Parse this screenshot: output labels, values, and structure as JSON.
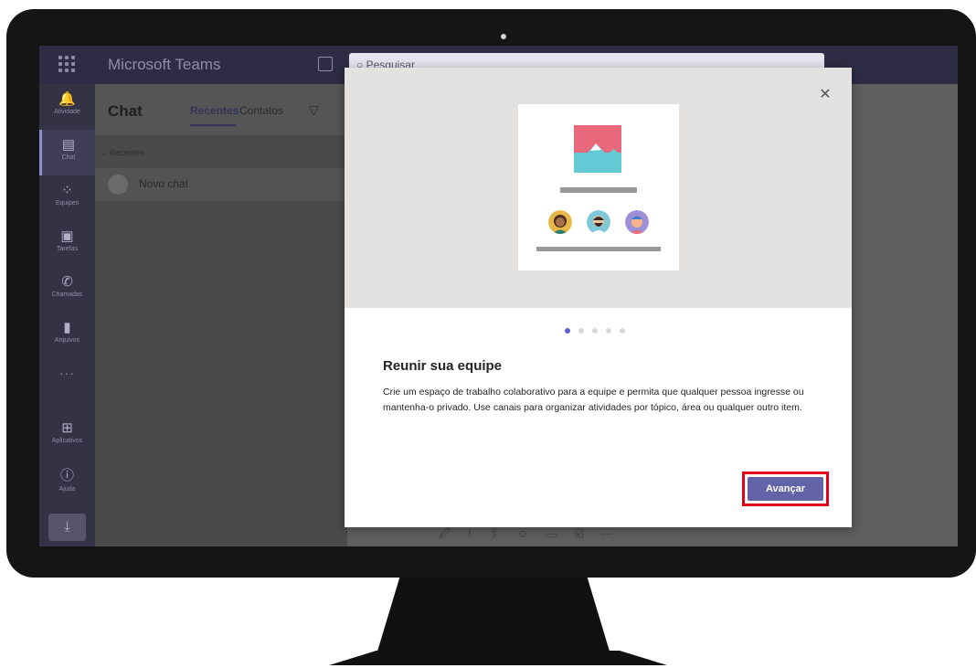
{
  "app": {
    "title": "Microsoft Teams",
    "search_placeholder": "Pesquisar"
  },
  "rail": {
    "items": [
      {
        "label": "Atividade",
        "icon": "bell-icon",
        "glyph": "🔔"
      },
      {
        "label": "Chat",
        "icon": "chat-icon",
        "glyph": "💬"
      },
      {
        "label": "Equipes",
        "icon": "teams-icon",
        "glyph": "👥"
      },
      {
        "label": "Tarefas",
        "icon": "tasks-icon",
        "glyph": "▣"
      },
      {
        "label": "Chamadas",
        "icon": "phone-icon",
        "glyph": "📞"
      },
      {
        "label": "Arquivos",
        "icon": "files-icon",
        "glyph": "▮"
      },
      {
        "label": "Aplicativos",
        "icon": "apps-icon",
        "glyph": "⊞"
      },
      {
        "label": "Ajuda",
        "icon": "help-icon",
        "glyph": "?"
      }
    ],
    "more": "···",
    "download_glyph": "⤓"
  },
  "chat_panel": {
    "title": "Chat",
    "tab_recentes": "Recentes",
    "tab_contatos": "Contatos",
    "section": "Recentes",
    "rows": [
      {
        "name": "Novo chat"
      }
    ]
  },
  "compose_icons": "🖉 ! 🖇 ☺ ▭ ☑ ⋯",
  "dialog": {
    "title": "Reunir sua equipe",
    "body": "Crie um espaço de trabalho colaborativo para a equipe e permita que qualquer pessoa ingresse ou mantenha-o privado. Use canais para organizar atividades por tópico, área ou qualquer outro item.",
    "next_label": "Avançar",
    "close_glyph": "✕",
    "page_index": 1,
    "page_count": 5
  },
  "colors": {
    "accent": "#6264a7",
    "highlight": "#e3001b",
    "titlebar": "#2d2c44"
  }
}
